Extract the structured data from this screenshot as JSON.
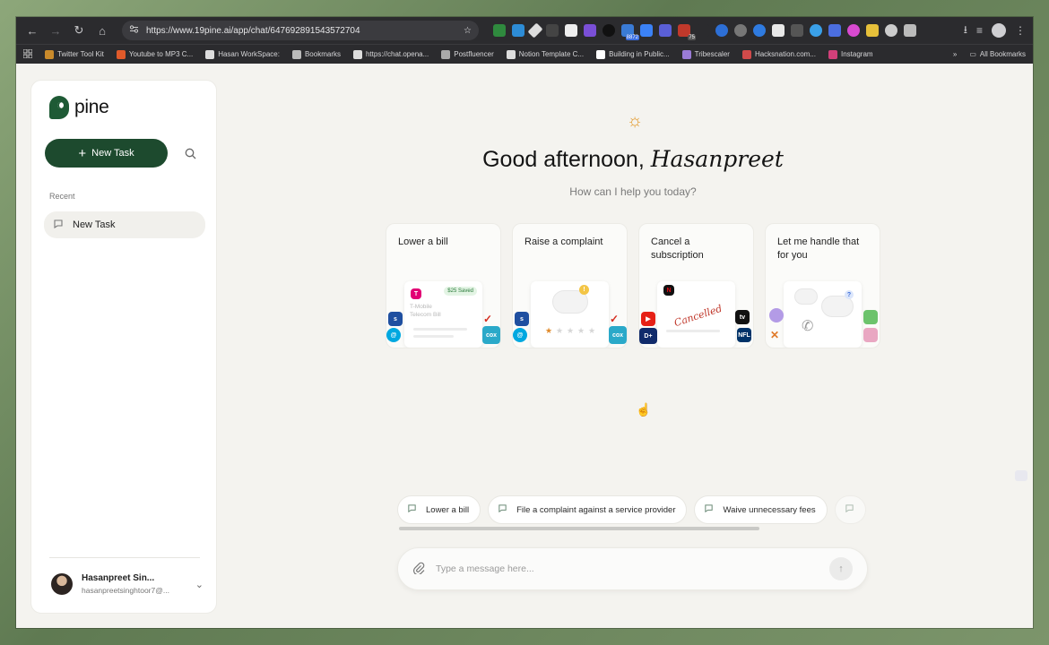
{
  "browser": {
    "url": "https://www.19pine.ai/app/chat/647692891543572704",
    "nav": {
      "back": "←",
      "forward": "→",
      "reload": "↻",
      "home": "⌂"
    },
    "extension_badges": {
      "ext7": "8872",
      "ext11": "75"
    },
    "bookmarks": [
      {
        "label": "Twitter Tool Kit",
        "color": "#c98a2b"
      },
      {
        "label": "Youtube to MP3 C...",
        "color": "#e05a2a"
      },
      {
        "label": "Hasan WorkSpace:",
        "color": "#dddddd"
      },
      {
        "label": "Bookmarks",
        "color": "#bbbbbb"
      },
      {
        "label": "https://chat.opena...",
        "color": "#dddddd"
      },
      {
        "label": "Postfluencer",
        "color": "#aaaaaa"
      },
      {
        "label": "Notion Template C...",
        "color": "#dddddd"
      },
      {
        "label": "Building in Public...",
        "color": "#ffffff"
      },
      {
        "label": "Tribescaler",
        "color": "#9a7bd6"
      },
      {
        "label": "Hacksnation.com...",
        "color": "#d04a4a"
      },
      {
        "label": "Instagram",
        "color": "#d2407a"
      }
    ],
    "all_bookmarks": "All Bookmarks",
    "icons": {
      "site_settings": "site-settings-icon",
      "star": "star-icon",
      "download": "download-icon",
      "menu": "menu-icon"
    }
  },
  "sidebar": {
    "logo_text": "pine",
    "new_task_label": "New Task",
    "recent_label": "Recent",
    "recent_items": [
      {
        "label": "New Task"
      }
    ],
    "user": {
      "name": "Hasanpreet Sin...",
      "email": "hasanpreetsinghtoor7@..."
    }
  },
  "main": {
    "greeting": "Good afternoon,",
    "greeting_name": "Hasanpreet",
    "subtitle": "How can I help you today?",
    "cards": [
      {
        "title": "Lower a bill",
        "art_saved": "$25 Saved",
        "art_text": "T-Mobile\nTelecom Bill"
      },
      {
        "title": "Raise a complaint"
      },
      {
        "title": "Cancel a subscription",
        "stamp": "Cancelled"
      },
      {
        "title": "Let me handle that for you"
      }
    ],
    "suggestions": [
      {
        "label": "Lower a bill"
      },
      {
        "label": "File a complaint against a service provider"
      },
      {
        "label": "Waive unnecessary fees"
      }
    ],
    "composer_placeholder": "Type a message here..."
  },
  "colors": {
    "brand_green": "#1d4a2e",
    "sun": "#e39a2d",
    "background": "#f4f3ef"
  }
}
